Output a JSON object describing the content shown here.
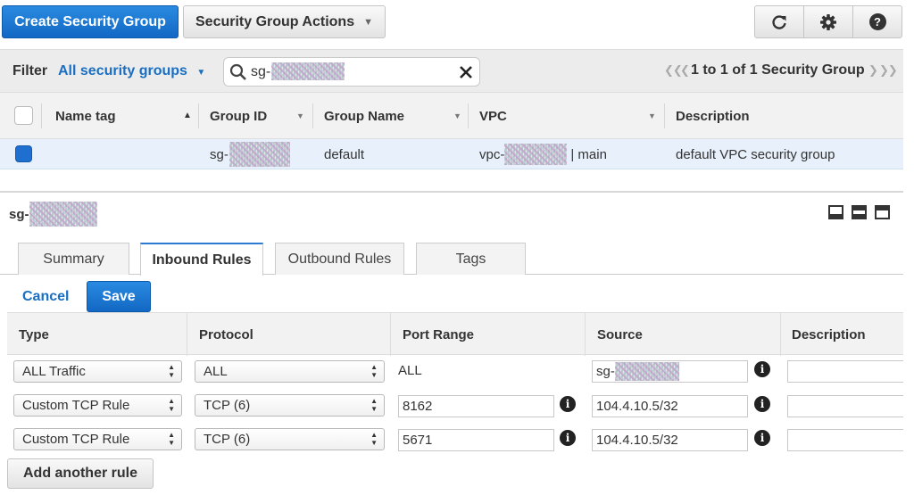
{
  "toolbar": {
    "create_label": "Create Security Group",
    "actions_label": "Security Group Actions"
  },
  "filter": {
    "label": "Filter",
    "dropdown_label": "All security groups",
    "search_value": "sg-",
    "pagination": "1 to 1 of 1 Security Group"
  },
  "table": {
    "headers": [
      "Name tag",
      "Group ID",
      "Group Name",
      "VPC",
      "Description"
    ],
    "row": {
      "name_tag": "",
      "group_id": "sg-",
      "group_name": "default",
      "vpc_prefix": "vpc-",
      "vpc_suffix": "| main",
      "description": "default VPC security group"
    }
  },
  "detail": {
    "title": "sg-",
    "tabs": [
      "Summary",
      "Inbound Rules",
      "Outbound Rules",
      "Tags"
    ],
    "active_tab": "Inbound Rules",
    "cancel_label": "Cancel",
    "save_label": "Save"
  },
  "rules": {
    "headers": [
      "Type",
      "Protocol",
      "Port Range",
      "Source",
      "Description"
    ],
    "rows": [
      {
        "type": "ALL Traffic",
        "protocol": "ALL",
        "port": "ALL",
        "source": "sg-"
      },
      {
        "type": "Custom TCP Rule",
        "protocol": "TCP (6)",
        "port": "8162",
        "source": "104.4.10.5/32"
      },
      {
        "type": "Custom TCP Rule",
        "protocol": "TCP (6)",
        "port": "5671",
        "source": "104.4.10.5/32"
      }
    ],
    "add_label": "Add another rule"
  },
  "colors": {
    "primary": "#1a73c9",
    "link": "#1a6fc2",
    "selected_row": "#e8f1fb"
  },
  "icons": [
    "refresh-icon",
    "gear-icon",
    "help-icon",
    "search-icon",
    "clear-icon",
    "info-icon",
    "panel-layout-icon"
  ]
}
